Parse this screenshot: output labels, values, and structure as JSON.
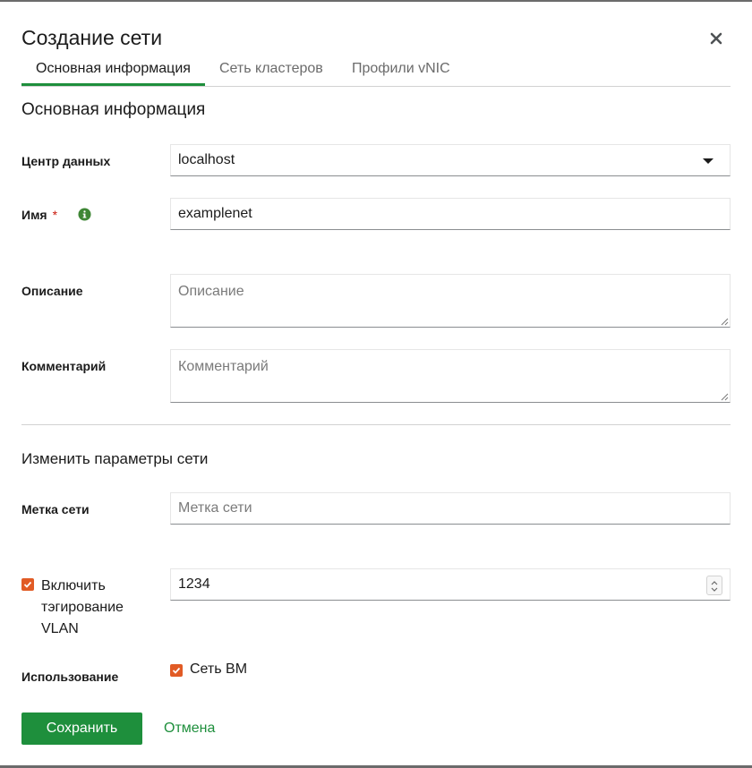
{
  "dialog": {
    "title": "Создание сети",
    "close_icon": "close-icon"
  },
  "tabs": [
    {
      "label": "Основная информация",
      "active": true
    },
    {
      "label": "Сеть кластеров",
      "active": false
    },
    {
      "label": "Профили vNIC",
      "active": false
    }
  ],
  "general": {
    "section_title": "Основная информация",
    "datacenter": {
      "label": "Центр данных",
      "value": "localhost"
    },
    "name": {
      "label": "Имя",
      "required_mark": "*",
      "value": "examplenet",
      "info_icon": "info-icon"
    },
    "description": {
      "label": "Описание",
      "placeholder": "Описание",
      "value": ""
    },
    "comment": {
      "label": "Комментарий",
      "placeholder": "Комментарий",
      "value": ""
    }
  },
  "network_params": {
    "section_title": "Изменить параметры сети",
    "network_label": {
      "label": "Метка сети",
      "placeholder": "Метка сети",
      "value": ""
    },
    "vlan": {
      "label": "Включить тэгирование VLAN",
      "checked": true,
      "value": "1234"
    },
    "usage": {
      "label": "Использование",
      "option_vm_network": {
        "label": "Сеть ВМ",
        "checked": true
      }
    }
  },
  "footer": {
    "save_label": "Сохранить",
    "cancel_label": "Отмена"
  },
  "colors": {
    "accent_green": "#1e8f3c",
    "checkbox_orange": "#e15b25",
    "required_red": "#c9190b"
  }
}
